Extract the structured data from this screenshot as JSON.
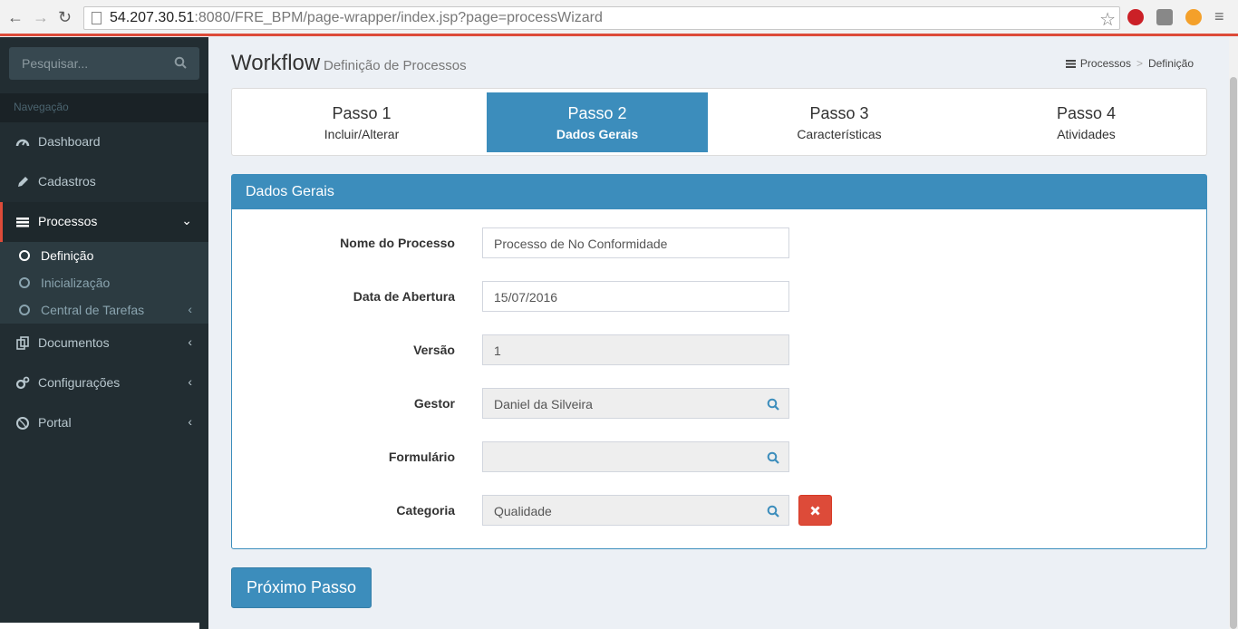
{
  "browser": {
    "url_host": "54.207.30.51",
    "url_rest": ":8080/FRE_BPM/page-wrapper/index.jsp?page=processWizard",
    "extension_icons": [
      "pinterest-icon",
      "extension-icon",
      "fire-extension-icon"
    ]
  },
  "sidebar": {
    "search_placeholder": "Pesquisar...",
    "nav_header": "Navegação",
    "items": [
      {
        "label": "Dashboard",
        "icon": "dashboard-icon"
      },
      {
        "label": "Cadastros",
        "icon": "pencil-icon"
      },
      {
        "label": "Processos",
        "icon": "list-icon",
        "active": true
      },
      {
        "label": "Documentos",
        "icon": "documents-icon"
      },
      {
        "label": "Configurações",
        "icon": "gears-icon"
      },
      {
        "label": "Portal",
        "icon": "dribbble-icon"
      }
    ],
    "subitems": [
      {
        "label": "Definição",
        "current": true
      },
      {
        "label": "Inicialização"
      },
      {
        "label": "Central de Tarefas"
      }
    ]
  },
  "header": {
    "title": "Workflow",
    "subtitle": "Definição de Processos",
    "breadcrumb": [
      "Processos",
      "Definição"
    ]
  },
  "wizard": {
    "steps": [
      {
        "title": "Passo 1",
        "subtitle": "Incluir/Alterar"
      },
      {
        "title": "Passo 2",
        "subtitle": "Dados Gerais",
        "active": true
      },
      {
        "title": "Passo 3",
        "subtitle": "Características"
      },
      {
        "title": "Passo 4",
        "subtitle": "Atividades"
      }
    ]
  },
  "form": {
    "title": "Dados Gerais",
    "fields": [
      {
        "label": "Nome do Processo",
        "value": "Processo de No Conformidade",
        "readonly": false
      },
      {
        "label": "Data de Abertura",
        "value": "15/07/2016",
        "readonly": false
      },
      {
        "label": "Versão",
        "value": "1",
        "readonly": true
      },
      {
        "label": "Gestor",
        "value": "Daniel da Silveira",
        "readonly": true,
        "search": true
      },
      {
        "label": "Formulário",
        "value": "",
        "readonly": true,
        "search": true
      },
      {
        "label": "Categoria",
        "value": "Qualidade",
        "readonly": true,
        "search": true,
        "delete": true
      }
    ],
    "next_button": "Próximo Passo"
  },
  "colors": {
    "primary": "#3c8dbc",
    "danger": "#dd4b39",
    "sidebar_bg": "#222d32"
  }
}
